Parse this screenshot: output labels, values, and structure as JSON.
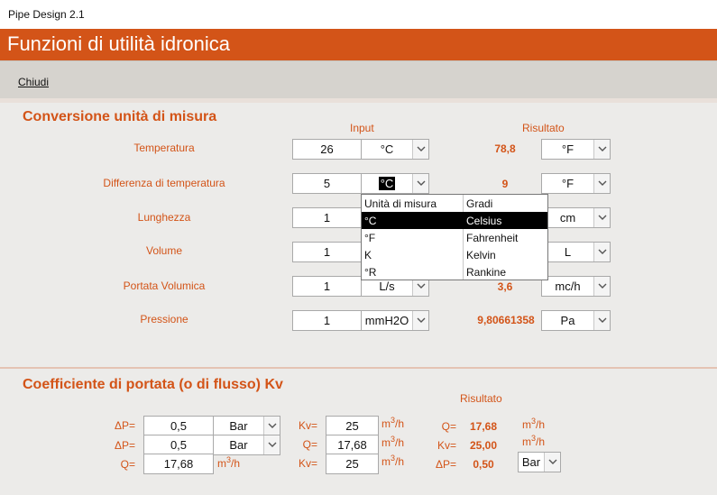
{
  "window": {
    "title": "Pipe Design 2.1"
  },
  "banner": {
    "title": "Funzioni di utilità idronica"
  },
  "menu": {
    "close_label": "Chiudi"
  },
  "conversion": {
    "title": "Conversione unità di misura",
    "input_header": "Input",
    "result_header": "Risultato",
    "rows": [
      {
        "label": "Temperatura",
        "value": "26",
        "unit_in": "°C",
        "result": "78,8",
        "unit_out": "°F"
      },
      {
        "label": "Differenza di temperatura",
        "value": "5",
        "unit_in": "°C",
        "result": "9",
        "unit_out": "°F"
      },
      {
        "label": "Lunghezza",
        "value": "1",
        "unit_in": "",
        "result": "",
        "unit_out": "cm"
      },
      {
        "label": "Volume",
        "value": "1",
        "unit_in": "",
        "result": "",
        "unit_out": "L"
      },
      {
        "label": "Portata Volumica",
        "value": "1",
        "unit_in": "L/s",
        "result": "3,6",
        "unit_out": "mc/h"
      },
      {
        "label": "Pressione",
        "value": "1",
        "unit_in": "mmH2O",
        "result": "9,80661358",
        "unit_out": "Pa"
      }
    ],
    "dropdown": {
      "headers": [
        "Unità di misura",
        "Gradi"
      ],
      "options": [
        {
          "symbol": "°C",
          "name": "Celsius",
          "selected": true
        },
        {
          "symbol": "°F",
          "name": "Fahrenheit",
          "selected": false
        },
        {
          "symbol": "K",
          "name": "Kelvin",
          "selected": false
        },
        {
          "symbol": "°R",
          "name": "Rankine",
          "selected": false
        }
      ]
    }
  },
  "kv": {
    "title": "Coefficiente di portata (o di flusso) Kv",
    "result_header": "Risultato",
    "rows": [
      {
        "label1": "ΔP=",
        "val1": "0,5",
        "unit1": "Bar",
        "label2": "Kv=",
        "val2": "25",
        "unit2_base": "m",
        "unit2_exp": "3",
        "unit2_tail": "/h",
        "res_label": "Q=",
        "res_value": "17,68",
        "res_unit_base": "m",
        "res_unit_exp": "3",
        "res_unit_tail": "/h"
      },
      {
        "label1": "ΔP=",
        "val1": "0,5",
        "unit1": "Bar",
        "label2": "Q=",
        "val2": "17,68",
        "unit2_base": "m",
        "unit2_exp": "3",
        "unit2_tail": "/h",
        "res_label": "Kv=",
        "res_value": "25,00",
        "res_unit_base": "m",
        "res_unit_exp": "3",
        "res_unit_tail": "/h"
      },
      {
        "label1": "Q=",
        "val1": "17,68",
        "unit1_base": "m",
        "unit1_exp": "3",
        "unit1_tail": "/h",
        "label2": "Kv=",
        "val2": "25",
        "unit2_base": "m",
        "unit2_exp": "3",
        "unit2_tail": "/h",
        "res_label": "ΔP=",
        "res_value": "0,50",
        "res_unit": "Bar"
      }
    ]
  }
}
